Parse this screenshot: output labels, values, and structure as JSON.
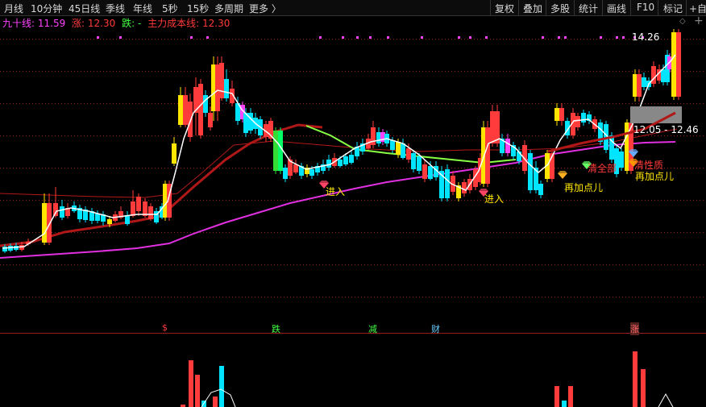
{
  "toolbar": {
    "periods": [
      "月线",
      "10分钟",
      "45日线",
      "季线",
      "年线",
      "5秒",
      "15秒",
      "多周期",
      "更多 〉"
    ],
    "tools": [
      "复权",
      "叠加",
      "多股",
      "统计",
      "画线",
      "F10",
      "标记",
      "+自"
    ]
  },
  "legend": {
    "ma90_label": "九十线: 11.59",
    "rise_label": "涨: 12.30",
    "fall_label": "跌: -",
    "cost_label": "主力成本线: 12.30"
  },
  "price_labels": {
    "high": "14.26",
    "range": "12.05 - 12.46"
  },
  "annotations": {
    "enter_1": "进入",
    "enter_2": "进入",
    "add_more_1": "再加点儿",
    "add_more_2": "再加点儿",
    "all_in": "清全部",
    "nature": "清性质"
  },
  "signals": {
    "s": "$",
    "fall": "跌",
    "reduce": "减",
    "wealth": "财",
    "rise": "涨"
  },
  "colors": {
    "up": "#ff3b3b",
    "down": "#00e5ff",
    "yellow": "#ffe600",
    "ma_white": "#ffffff",
    "ma_darkred": "#b01818",
    "ma_magenta": "#e030e0",
    "ma_green": "#88ff44",
    "grid": "#9b1b1b"
  }
}
